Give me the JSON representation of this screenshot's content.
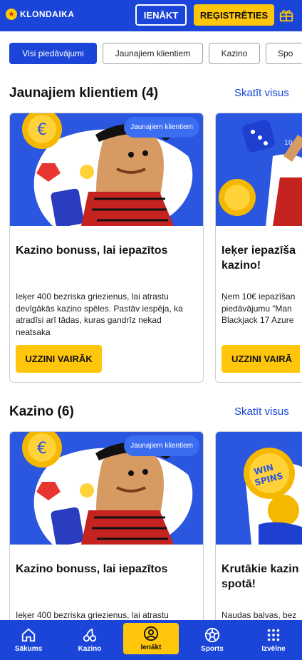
{
  "header": {
    "logo_text": "KLONDAIKA",
    "login_label": "IENĀKT",
    "register_label": "REĢISTRĒTIES",
    "gift_icon": "gift-icon"
  },
  "filters": [
    {
      "label": "Visi piedāvājumi",
      "active": true
    },
    {
      "label": "Jaunajiem klientiem",
      "active": false
    },
    {
      "label": "Kazino",
      "active": false
    },
    {
      "label": "Spo",
      "active": false
    }
  ],
  "sections": [
    {
      "title": "Jaunajiem klientiem (4)",
      "see_all": "Skatīt visus",
      "cards": [
        {
          "badge": "Jaunajiem klientiem",
          "title": "Kazino bonuss, lai iepazītos",
          "desc": "Ieķer 400 bezriska griezienus, lai atrastu devīgākās kazino spēles. Pastāv iespēja, ka atradīsi arī tādas, kuras gandrīz nekad neatsaka",
          "button": "UZZINI VAIRĀK"
        },
        {
          "badge": "",
          "title": "Ieķer iepazīša kazino!",
          "desc": "Ņem 10€ iepazīšan piedāvājumu “Man Blackjack 17 Azure",
          "button": "UZZINI VAIRĀ"
        }
      ]
    },
    {
      "title": "Kazino (6)",
      "see_all": "Skatīt visus",
      "cards": [
        {
          "badge": "Jaunajiem klientiem",
          "title": "Kazino bonuss, lai iepazītos",
          "desc": "Ieķer 400 bezriska griezienus, lai atrastu",
          "button": ""
        },
        {
          "badge": "",
          "title": "Krutākie kazin spotā!",
          "desc": "Naudas balvas, bez",
          "button": ""
        }
      ]
    }
  ],
  "bottom_nav": [
    {
      "label": "Sākums",
      "icon": "home-icon",
      "active": false
    },
    {
      "label": "Kazino",
      "icon": "cherry-icon",
      "active": false
    },
    {
      "label": "Ienākt",
      "icon": "user-icon",
      "active": true
    },
    {
      "label": "Sports",
      "icon": "ball-icon",
      "active": false
    },
    {
      "label": "Izvēlne",
      "icon": "menu-grid-icon",
      "active": false
    }
  ],
  "colors": {
    "brand_blue": "#1a45d8",
    "accent_yellow": "#ffc60b"
  }
}
